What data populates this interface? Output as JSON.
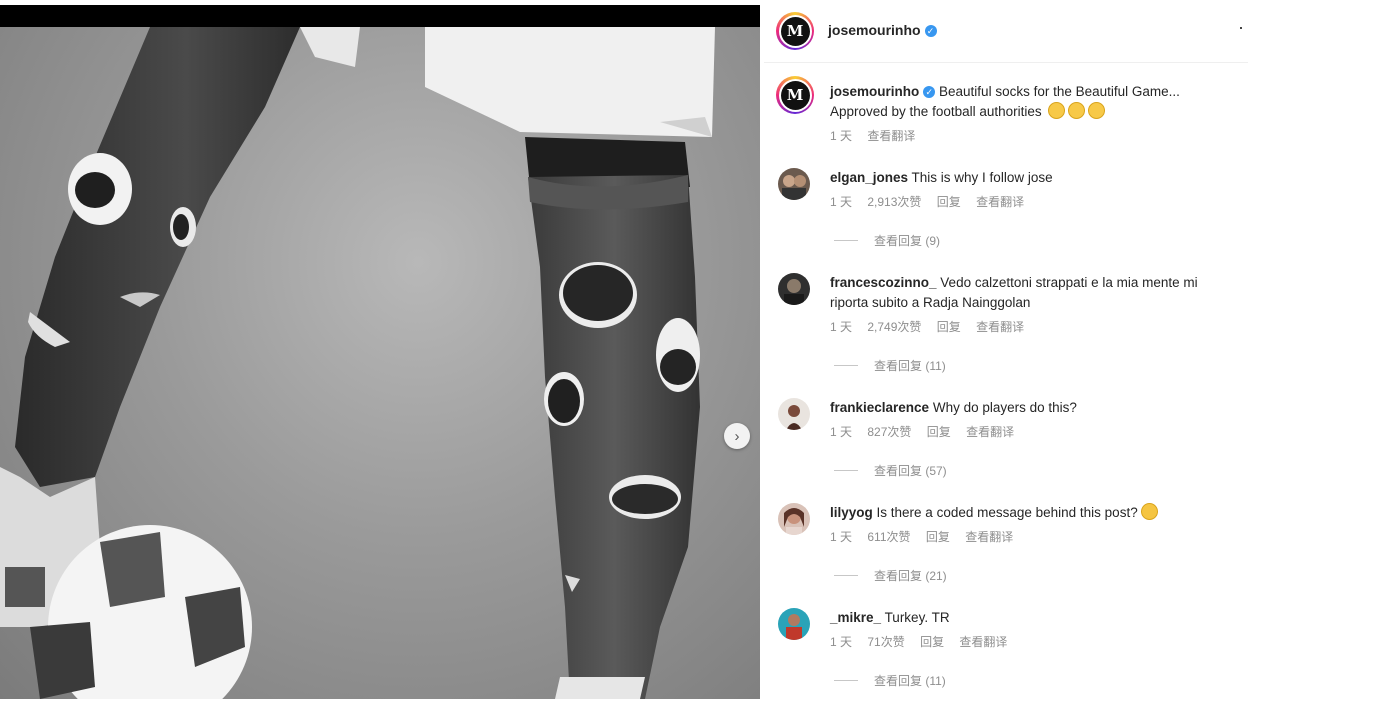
{
  "post": {
    "username": "josemourinho",
    "avatar_letter": "M"
  },
  "caption": {
    "username": "josemourinho",
    "text": "Beautiful socks for the Beautiful Game... Approved by the football authorities",
    "emojis": [
      "grimace-emoji",
      "grimace-emoji",
      "grimace-emoji"
    ],
    "time": "1 天",
    "translate": "查看翻译"
  },
  "comments": [
    {
      "username": "elgan_jones",
      "text": "This is why I follow jose",
      "time": "1 天",
      "likes": "2,913次赞",
      "reply": "回复",
      "translate": "查看翻译",
      "view_replies": "查看回复 (9)"
    },
    {
      "username": "francescozinno_",
      "text": "Vedo calzettoni strappati e la mia mente mi riporta subito a Radja Nainggolan",
      "time": "1 天",
      "likes": "2,749次赞",
      "reply": "回复",
      "translate": "查看翻译",
      "view_replies": "查看回复 (11)"
    },
    {
      "username": "frankieclarence",
      "text": "Why do players do this?",
      "time": "1 天",
      "likes": "827次赞",
      "reply": "回复",
      "translate": "查看翻译",
      "view_replies": "查看回复 (57)"
    },
    {
      "username": "lilyyog",
      "text": "Is there a coded message behind this post?",
      "time": "1 天",
      "likes": "611次赞",
      "reply": "回复",
      "translate": "查看翻译",
      "view_replies": "查看回复 (21)"
    },
    {
      "username": "_mikre_",
      "text": "Turkey. TR",
      "time": "1 天",
      "likes": "71次赞",
      "reply": "回复",
      "translate": "查看翻译",
      "view_replies": "查看回复 (11)"
    }
  ],
  "icons": {
    "verified": "✓",
    "more": "·",
    "next": "›"
  },
  "colors": {
    "verified_blue": "#3897f0",
    "meta_gray": "#8e8e8e"
  }
}
